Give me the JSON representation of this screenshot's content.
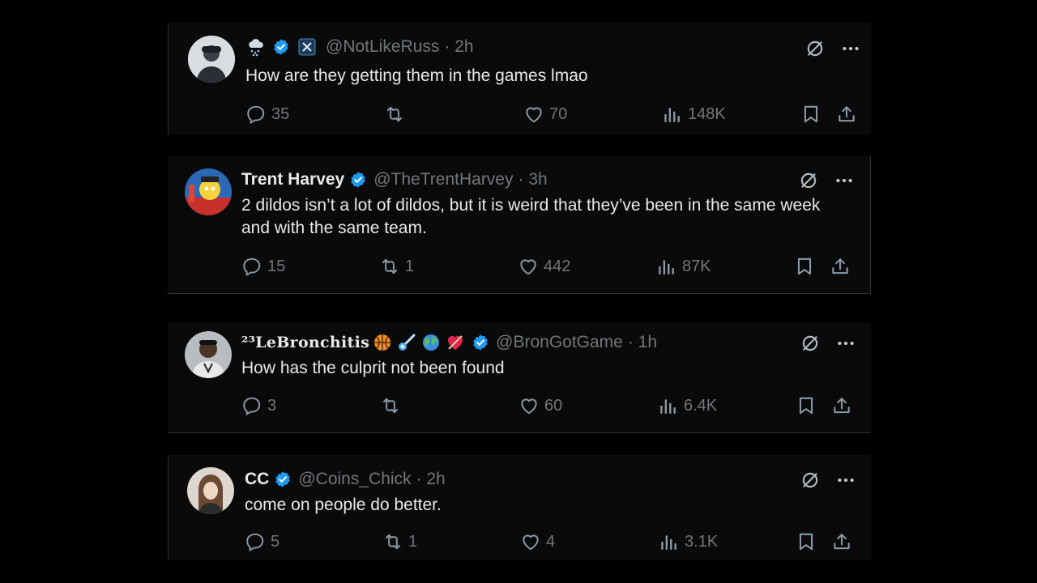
{
  "colors": {
    "background": "#000000",
    "card": "#0a0a0b",
    "verified": "#1d9bf0",
    "muted": "#71767b",
    "text": "#e7e9ea"
  },
  "tweets": [
    {
      "name": "",
      "handle": "@NotLikeRuss",
      "time": "· 2h",
      "text": "How are they getting them in the games lmao",
      "replies": "35",
      "reposts": "",
      "likes": "70",
      "views": "148K",
      "name_icons": [
        "cloud-snow-emoji",
        "verified-badge",
        "x-app-icon"
      ]
    },
    {
      "name": "Trent Harvey",
      "handle": "@TheTrentHarvey",
      "time": "· 3h",
      "text": "2 dildos isn’t a lot of dildos, but it is weird that they’ve been in the same week and with the same team.",
      "replies": "15",
      "reposts": "1",
      "likes": "442",
      "views": "87K",
      "name_icons": [
        "verified-badge"
      ]
    },
    {
      "name": "²³LeBronchitis",
      "handle": "@BronGotGame",
      "time": "· 1h",
      "text": "How has the culprit not been found",
      "replies": "3",
      "reposts": "",
      "likes": "60",
      "views": "6.4K",
      "name_icons": [
        "basketball-emoji",
        "comet-emoji",
        "globe-emoji",
        "heart-emoji",
        "verified-badge"
      ]
    },
    {
      "name": "CC",
      "handle": "@Coins_Chick",
      "time": "· 2h",
      "text": "come on people do better.",
      "replies": "5",
      "reposts": "1",
      "likes": "4",
      "views": "3.1K",
      "name_icons": [
        "verified-badge"
      ]
    }
  ]
}
